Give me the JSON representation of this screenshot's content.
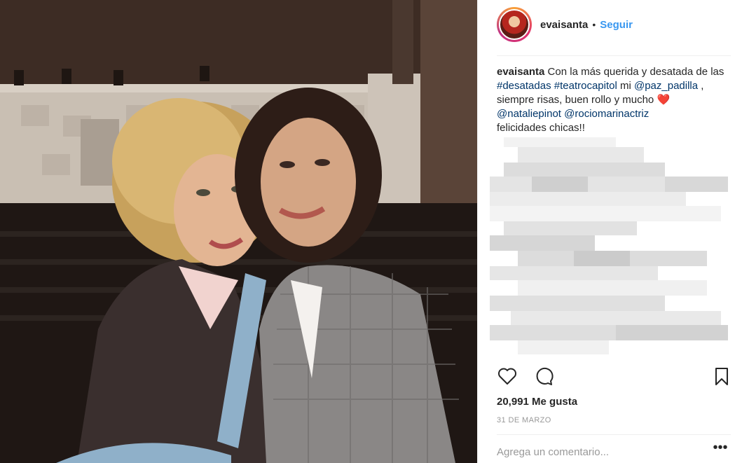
{
  "post": {
    "username": "evaisanta",
    "separator": "•",
    "follow_label": "Seguir",
    "caption": {
      "username": "evaisanta",
      "text_1": " Con la más querida y desatada de las ",
      "hashtag_1": "#desatadas",
      "hashtag_2": "#teatrocapitol",
      "text_2": " mi ",
      "mention_1": "@paz_padilla",
      "text_3": " , siempre risas, buen rollo y mucho ",
      "heart": "❤️",
      "mention_2": "@nataliepinot",
      "mention_3": "@rociomarinactriz",
      "text_4": "felicidades chicas!!"
    },
    "likes_text": "20,991 Me gusta",
    "date_text": "31 DE MARZO",
    "comment_placeholder": "Agrega un comentario...",
    "more_label": "•••"
  },
  "icons": [
    "heart-icon",
    "comment-icon",
    "bookmark-icon",
    "more-options-icon"
  ],
  "colors": {
    "link": "#003569",
    "follow": "#3897f0",
    "text": "#262626",
    "muted": "#999999"
  }
}
